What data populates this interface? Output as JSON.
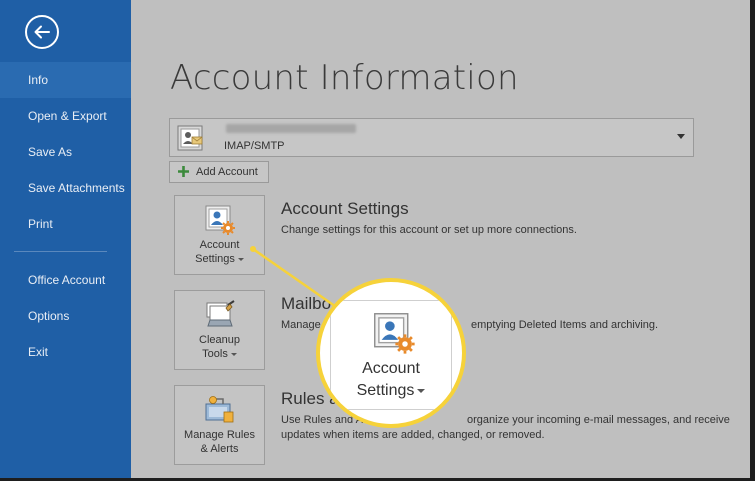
{
  "sidebar": {
    "items": [
      {
        "label": "Info",
        "active": true
      },
      {
        "label": "Open & Export"
      },
      {
        "label": "Save As"
      },
      {
        "label": "Save Attachments"
      },
      {
        "label": "Print"
      },
      {
        "label": "Office Account"
      },
      {
        "label": "Options"
      },
      {
        "label": "Exit"
      }
    ]
  },
  "main": {
    "title": "Account Information",
    "account": {
      "type": "IMAP/SMTP"
    },
    "add_account_label": "Add Account",
    "sections": [
      {
        "tile_line1": "Account",
        "tile_line2": "Settings",
        "heading": "Account Settings",
        "description": "Change settings for this account or set up more connections."
      },
      {
        "tile_line1": "Cleanup",
        "tile_line2": "Tools",
        "heading": "Mailbo",
        "description_left": "Manage",
        "description_right": "emptying Deleted Items and archiving."
      },
      {
        "tile_line1": "Manage Rules",
        "tile_line2": "& Alerts",
        "heading": "Rules a",
        "description_left": "Use Rules and A",
        "description_right": "organize your incoming e-mail messages, and receive",
        "description_line2": "updates when items are added, changed, or removed."
      }
    ]
  },
  "callout": {
    "line1": "Account",
    "line2": "Settings"
  },
  "colors": {
    "sidebar": "#1f5fa6",
    "sidebar_active": "#2a6bb1",
    "highlight": "#f6d23a",
    "background": "#bfbfbf"
  },
  "icons": {
    "back": "back-arrow-icon",
    "account": "account-icon",
    "dropdown": "chevron-down-icon",
    "add": "plus-icon",
    "account_settings": "account-settings-icon",
    "cleanup": "cleanup-tools-icon",
    "rules": "rules-alerts-icon"
  }
}
